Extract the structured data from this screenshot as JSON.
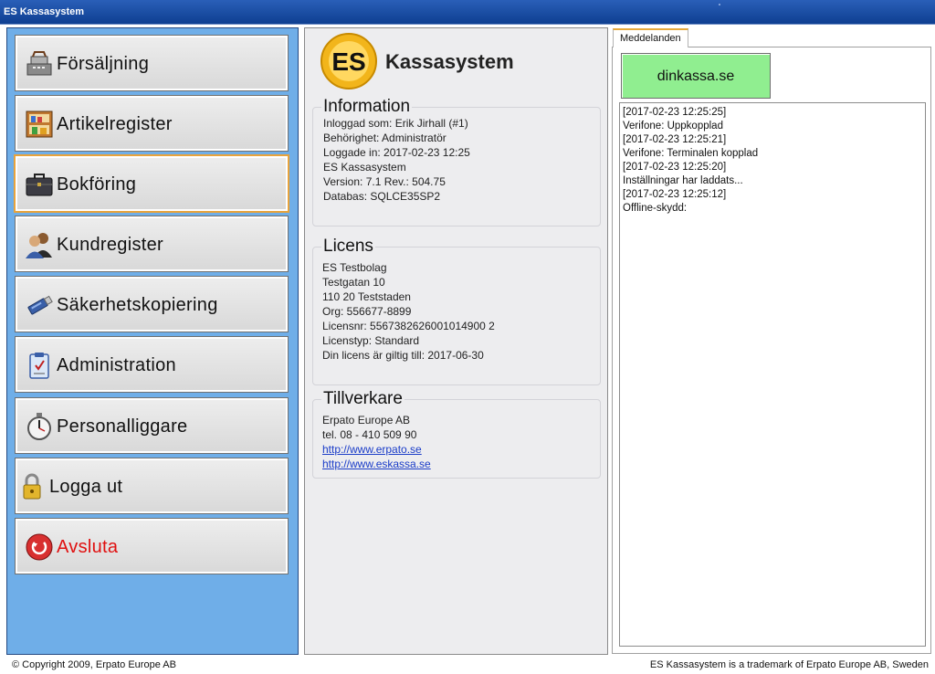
{
  "window": {
    "title": "ES Kassasystem"
  },
  "nav": [
    {
      "label": "Försäljning",
      "icon": "cash-register-icon"
    },
    {
      "label": "Artikelregister",
      "icon": "shelf-icon"
    },
    {
      "label": "Bokföring",
      "icon": "briefcase-icon",
      "selected": true
    },
    {
      "label": "Kundregister",
      "icon": "people-icon"
    },
    {
      "label": "Säkerhetskopiering",
      "icon": "usb-drive-icon"
    },
    {
      "label": "Administration",
      "icon": "clipboard-icon"
    },
    {
      "label": "Personalliggare",
      "icon": "stopwatch-icon"
    },
    {
      "label": "Logga ut",
      "icon": "padlock-icon"
    },
    {
      "label": "Avsluta",
      "icon": "exit-icon"
    }
  ],
  "brand": {
    "logo_text": "ES",
    "name": "Kassasystem"
  },
  "information": {
    "title": "Information",
    "lines": [
      "Inloggad som: Erik Jirhall (#1)",
      "Behörighet: Administratör",
      "Loggade in: 2017-02-23 12:25",
      "ES Kassasystem",
      "Version:  7.1 Rev.: 504.75",
      "Databas: SQLCE35SP2"
    ]
  },
  "licens": {
    "title": "Licens",
    "lines": [
      "ES Testbolag",
      "Testgatan 10",
      "110 20   Teststaden",
      "Org: 556677-8899",
      "Licensnr: 5567382626001014900 2",
      "Licenstyp: Standard",
      "Din licens är giltig till: 2017-06-30"
    ]
  },
  "tillverkare": {
    "title": "Tillverkare",
    "lines": [
      "Erpato Europe AB",
      "tel. 08 - 410 509 90"
    ],
    "links": [
      "http://www.erpato.se",
      "http://www.eskassa.se"
    ]
  },
  "messages": {
    "tab_label": "Meddelanden",
    "dinkassa_label": "dinkassa.se",
    "log": [
      "[2017-02-23 12:25:25]",
      "Verifone: Uppkopplad",
      "[2017-02-23 12:25:21]",
      "Verifone: Terminalen kopplad",
      "[2017-02-23 12:25:20]",
      "Inställningar har laddats...",
      "[2017-02-23 12:25:12]",
      "Offline-skydd:"
    ]
  },
  "footer": {
    "copyright": "© Copyright 2009, Erpato Europe AB",
    "trademark": "ES Kassasystem is a trademark of Erpato Europe AB, Sweden"
  },
  "colors": {
    "sidebar_bg": "#6faee8",
    "selected_outline": "#e8a33c",
    "exit_text": "#e01010",
    "dinkassa_bg": "#90ee90"
  }
}
